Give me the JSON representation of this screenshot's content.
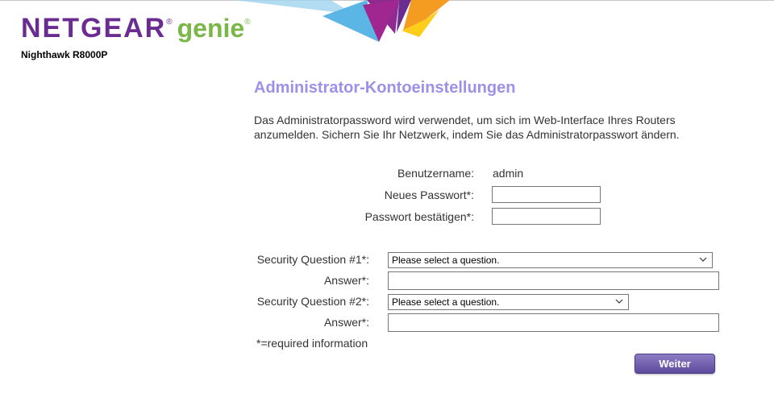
{
  "header": {
    "brand": "NETGEAR",
    "brand_reg": "®",
    "product": "genie",
    "product_mark": "®",
    "model": "Nighthawk R8000P",
    "colors": {
      "brand_purple": "#6b2c91",
      "genie_green": "#7ab648",
      "title_purple": "#9c91e8"
    }
  },
  "page": {
    "title": "Administrator-Kontoeinstellungen",
    "description": "Das Administratorpassword wird verwendet, um sich im Web-Interface Ihres Routers anzumelden. Sichern Sie Ihr Netzwerk, indem Sie das Administratorpasswort ändern."
  },
  "form": {
    "username_label": "Benutzername:",
    "username_value": "admin",
    "new_password_label": "Neues Passwort*:",
    "new_password_value": "",
    "confirm_password_label": "Passwort bestätigen*:",
    "confirm_password_value": "",
    "security_q1_label": "Security Question #1*:",
    "security_q1_selected": "Please select a question.",
    "answer1_label": "Answer*:",
    "answer1_value": "",
    "security_q2_label": "Security Question #2*:",
    "security_q2_selected": "Please select a question.",
    "answer2_label": "Answer*:",
    "answer2_value": "",
    "required_note": "*=required information",
    "next_button": "Weiter"
  }
}
